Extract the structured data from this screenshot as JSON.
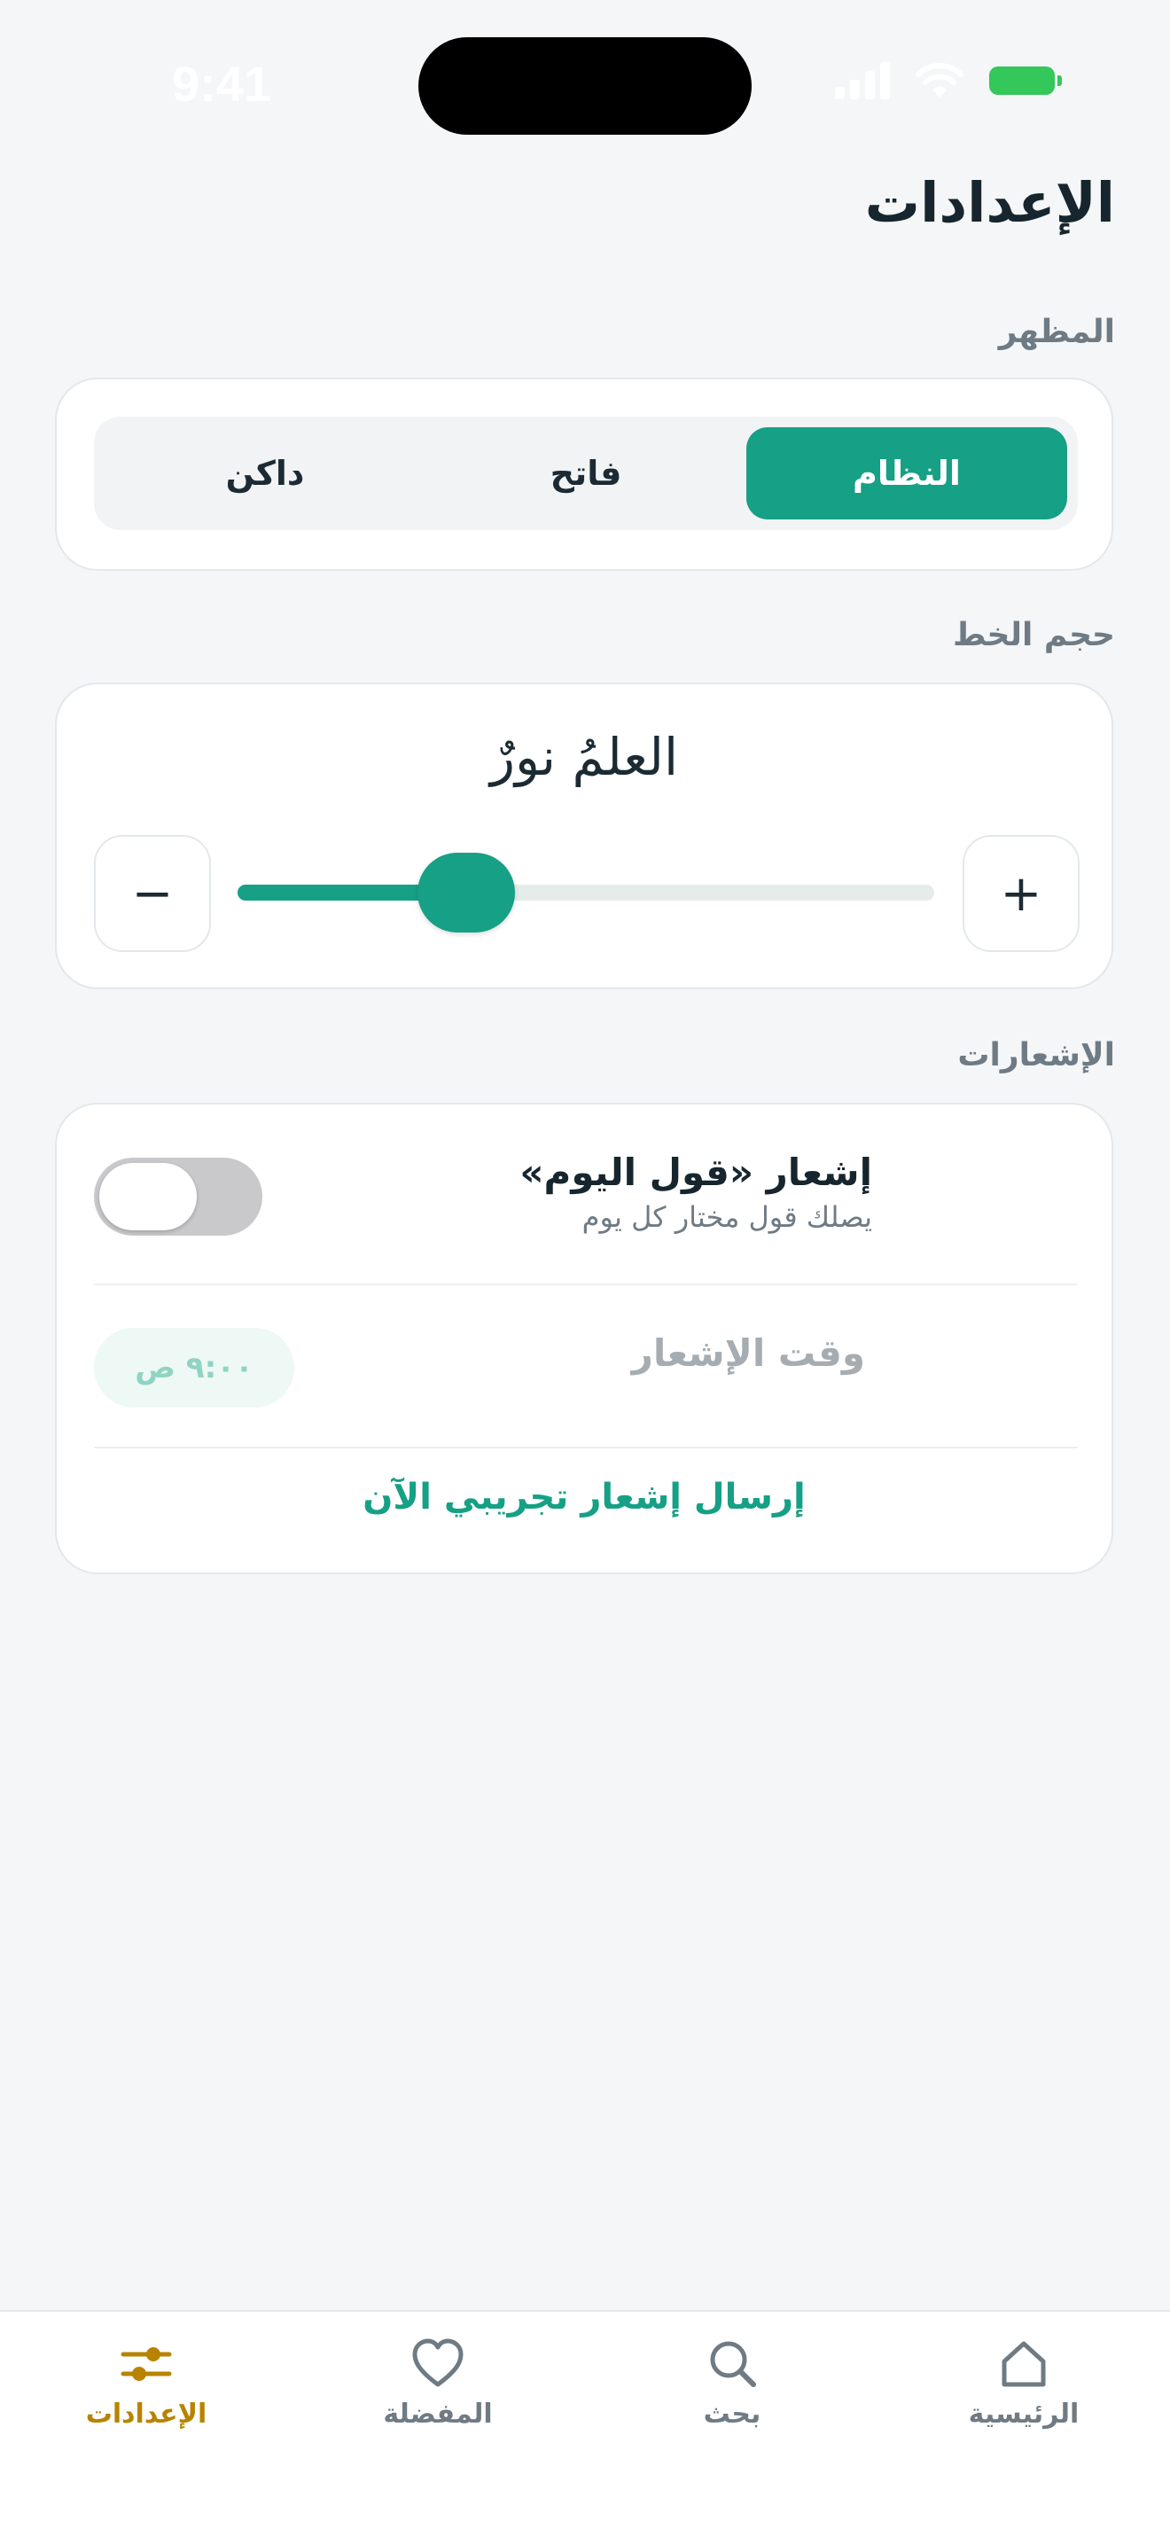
{
  "status_bar": {
    "time": "9:41"
  },
  "page": {
    "title": "الإعدادات"
  },
  "appearance": {
    "section_label": "المظهر",
    "options": [
      "النظام",
      "فاتح",
      "داكن"
    ],
    "selected": "النظام"
  },
  "font_size": {
    "section_label": "حجم الخط",
    "preview_text": "العلمُ نورٌ",
    "increase_label": "+",
    "decrease_label": "−",
    "level": 0.3
  },
  "notifications": {
    "section_label": "الإشعارات",
    "daily_title": "إشعار «قول اليوم»",
    "daily_subtitle": "يصلك قول مختار كل يوم",
    "daily_enabled": false,
    "time_label": "وقت الإشعار",
    "time_value": "٩:٠٠ ص",
    "test_button": "إرسال إشعار تجريبي الآن"
  },
  "tabbar": {
    "items": [
      {
        "label": "الرئيسية",
        "icon": "home-icon"
      },
      {
        "label": "بحث",
        "icon": "search-icon"
      },
      {
        "label": "المفضلة",
        "icon": "heart-icon"
      },
      {
        "label": "الإعدادات",
        "icon": "sliders-icon"
      }
    ],
    "active": "الإعدادات",
    "active_color": "#b78300"
  },
  "colors": {
    "accent": "#16a085",
    "background": "#f4f6f8"
  }
}
